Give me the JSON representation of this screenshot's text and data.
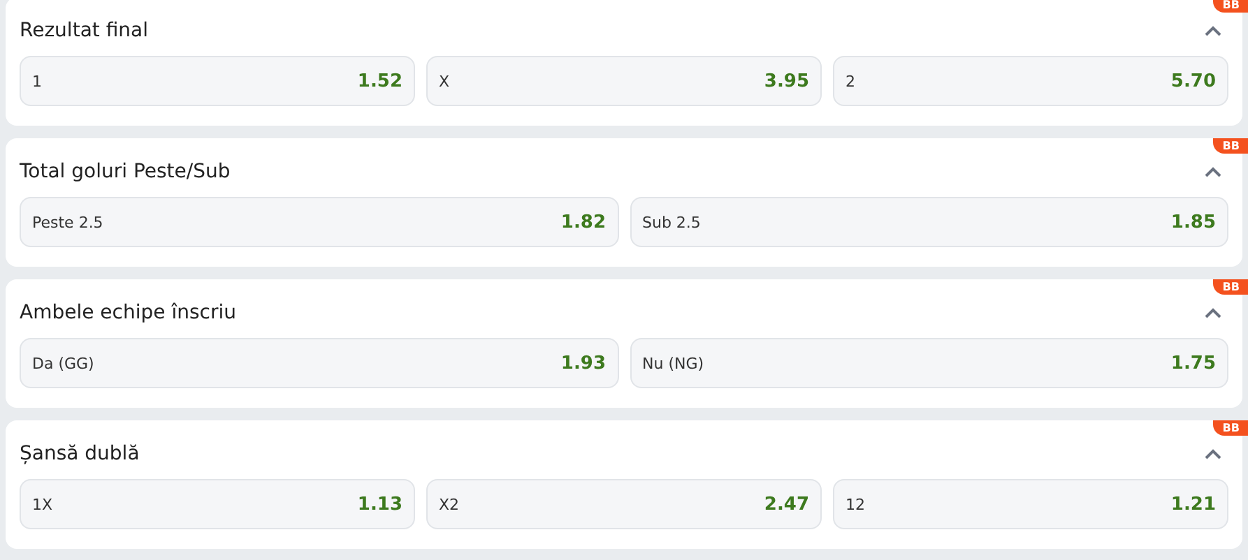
{
  "markets": [
    {
      "title": "Rezultat final",
      "badge": "BB",
      "expanded": true,
      "odds": [
        {
          "label": "1",
          "value": "1.52"
        },
        {
          "label": "X",
          "value": "3.95"
        },
        {
          "label": "2",
          "value": "5.70"
        }
      ]
    },
    {
      "title": "Total goluri Peste/Sub",
      "badge": "BB",
      "expanded": true,
      "odds": [
        {
          "label": "Peste 2.5",
          "value": "1.82"
        },
        {
          "label": "Sub 2.5",
          "value": "1.85"
        }
      ]
    },
    {
      "title": "Ambele echipe înscriu",
      "badge": "BB",
      "expanded": true,
      "odds": [
        {
          "label": "Da (GG)",
          "value": "1.93"
        },
        {
          "label": "Nu (NG)",
          "value": "1.75"
        }
      ]
    },
    {
      "title": "Șansă dublă",
      "badge": "BB",
      "expanded": true,
      "odds": [
        {
          "label": "1X",
          "value": "1.13"
        },
        {
          "label": "X2",
          "value": "2.47"
        },
        {
          "label": "12",
          "value": "1.21"
        }
      ]
    }
  ]
}
